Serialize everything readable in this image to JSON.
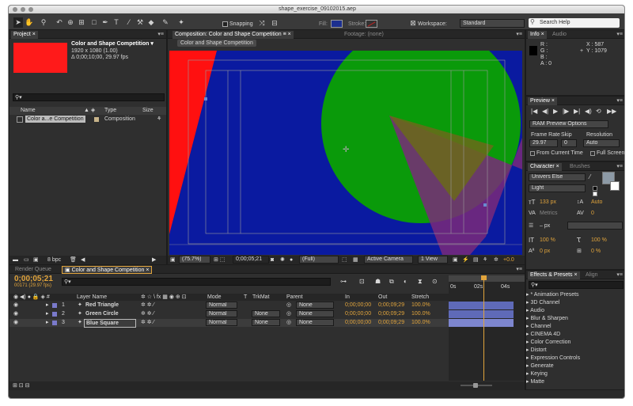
{
  "window": {
    "title": "shape_exercise_09102015.aep"
  },
  "toolbar": {
    "snapping_label": "Snapping",
    "fill_label": "Fill:",
    "stroke_label": "Stroke:",
    "workspace_label": "Workspace:",
    "workspace_value": "Standard",
    "search_help_placeholder": "Search Help",
    "fill_color": "#1c2f8f",
    "stroke_color": "#cc2222"
  },
  "project": {
    "tab": "Project",
    "comp_name": "Color and Shape Competition ▾",
    "comp_size": "1920 x 1080 (1.00)",
    "comp_duration": "Δ 0;00;10;00, 29.97 fps",
    "thumb_color": "#ff1a1a",
    "col_name": "Name",
    "col_type": "Type",
    "col_size": "Size",
    "item_name": "Color a...e Competition",
    "item_type": "Composition",
    "bpc": "8 bpc"
  },
  "composition": {
    "tab": "Composition: Color and Shape Competition",
    "footage_tab": "Footage: (none)",
    "breadcrumb": "Color and Shape Competition",
    "zoom": "(75.7%)",
    "timecode": "0;00;05;21",
    "resolution": "(Full)",
    "camera": "Active Camera",
    "view": "1 View",
    "exposure": "+0.0"
  },
  "info": {
    "tab": "Info",
    "audio_tab": "Audio",
    "r": "R :",
    "g": "G :",
    "b": "B :",
    "a": "A : 0",
    "x": "X : 587",
    "y": "Y : 1079"
  },
  "preview": {
    "tab": "Preview",
    "options": "RAM Preview Options",
    "frame_rate_label": "Frame Rate",
    "skip_label": "Skip",
    "resolution_label": "Resolution",
    "frame_rate": "29.97",
    "skip": "0",
    "resolution": "Auto",
    "from_current": "From Current Time",
    "full_screen": "Full Screen"
  },
  "character": {
    "tab": "Character",
    "brushes_tab": "Brushes",
    "font": "Univers Else",
    "style": "Light",
    "size": "133 px",
    "leading": "Auto",
    "kerning": "Metrics",
    "tracking": "0",
    "stroke_width": "– px",
    "vscale": "100 %",
    "hscale": "100 %",
    "baseline": "0 px",
    "tsume": "0 %"
  },
  "effects": {
    "tab": "Effects & Presets",
    "align_tab": "Align",
    "categories": [
      "* Animation Presets",
      "3D Channel",
      "Audio",
      "Blur & Sharpen",
      "Channel",
      "CINEMA 4D",
      "Color Correction",
      "Distort",
      "Expression Controls",
      "Generate",
      "Keying",
      "Matte"
    ]
  },
  "bottom_tabs": {
    "render_queue": "Render Queue",
    "timeline": "Color and Shape Competition"
  },
  "timeline": {
    "timecode": "0;00;05;21",
    "frames": "00171 (29.97 fps)",
    "cols": {
      "layer_name": "Layer Name",
      "mode": "Mode",
      "t": "T",
      "trkmat": "TrkMat",
      "parent": "Parent",
      "in": "In",
      "out": "Out",
      "stretch": "Stretch"
    },
    "ruler": [
      "0s",
      "02s",
      "04s"
    ],
    "layers": [
      {
        "num": "1",
        "name": "Red Triangle",
        "mode": "Normal",
        "trkmat": "",
        "parent": "None",
        "in": "0;00;00;00",
        "out": "0;00;09;29",
        "stretch": "100.0%",
        "label": "#7a7acb"
      },
      {
        "num": "2",
        "name": "Green Circle",
        "mode": "Normal",
        "trkmat": "None",
        "parent": "None",
        "in": "0;00;00;00",
        "out": "0;00;09;29",
        "stretch": "100.0%",
        "label": "#7a7acb"
      },
      {
        "num": "3",
        "name": "Blue Square",
        "mode": "Normal",
        "trkmat": "None",
        "parent": "None",
        "in": "0;00;00;00",
        "out": "0;00;09;29",
        "stretch": "100.0%",
        "label": "#7a7acb"
      }
    ]
  }
}
